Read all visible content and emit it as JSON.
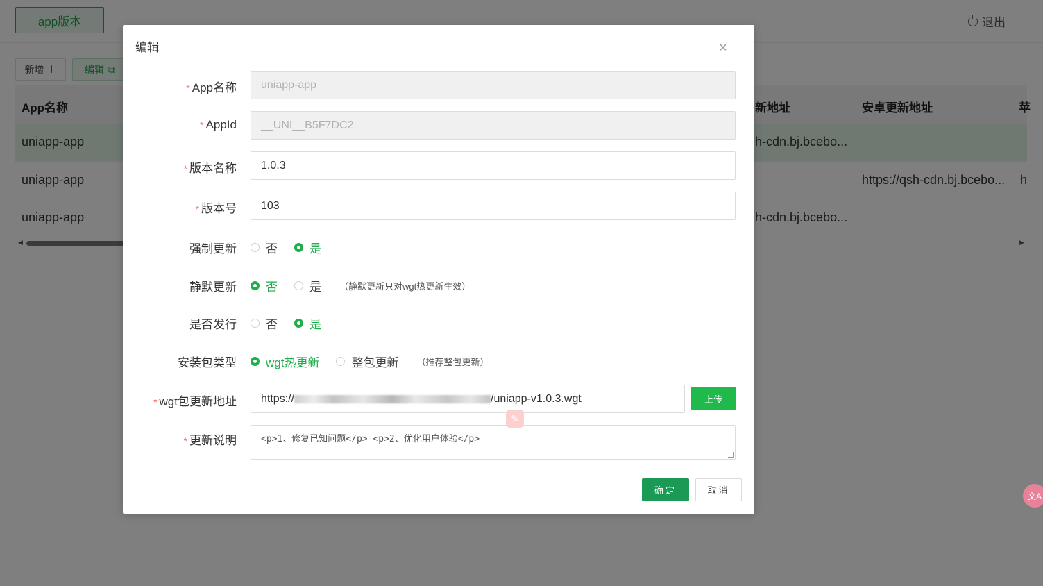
{
  "header": {
    "tab_label": "app版本",
    "logout_label": "退出"
  },
  "toolbar": {
    "add_label": "新增 ＋",
    "edit_label": "编辑"
  },
  "table": {
    "headers": [
      "App名称",
      "新地址",
      "安卓更新地址",
      "苹"
    ],
    "rows": [
      {
        "app_name": "uniapp-app",
        "col_update": "h-cdn.bj.bcebo...",
        "android_url": ""
      },
      {
        "app_name": "uniapp-app",
        "col_update": "",
        "android_url": "https://qsh-cdn.bj.bcebo...",
        "extra": "h"
      },
      {
        "app_name": "uniapp-app",
        "col_update": "h-cdn.bj.bcebo...",
        "android_url": ""
      }
    ]
  },
  "modal": {
    "title": "编辑",
    "close_glyph": "×",
    "fields": {
      "app_name": {
        "label": "App名称",
        "value": "uniapp-app"
      },
      "app_id": {
        "label": "AppId",
        "value": "__UNI__B5F7DC2"
      },
      "version_name": {
        "label": "版本名称",
        "value": "1.0.3"
      },
      "version_code": {
        "label": "版本号",
        "value": "103"
      },
      "force_update": {
        "label": "强制更新",
        "options": [
          "否",
          "是"
        ],
        "selected": "是"
      },
      "silent_update": {
        "label": "静默更新",
        "options": [
          "否",
          "是"
        ],
        "selected": "否",
        "hint": "（静默更新只对wgt热更新生效）"
      },
      "published": {
        "label": "是否发行",
        "options": [
          "否",
          "是"
        ],
        "selected": "是"
      },
      "package_type": {
        "label": "安装包类型",
        "options": [
          "wgt热更新",
          "整包更新"
        ],
        "selected": "wgt热更新",
        "hint": "（推荐整包更新）"
      },
      "wgt_url": {
        "label": "wgt包更新地址",
        "prefix": "https://",
        "suffix": "/uniapp-v1.0.3.wgt",
        "upload_label": "上传"
      },
      "release_notes": {
        "label": "更新说明",
        "value": "<p>1、修复已知问题</p> <p>2、优化用户体验</p>"
      }
    },
    "ok_label": "确定",
    "cancel_label": "取消"
  },
  "colors": {
    "accent": "#1fae4b",
    "required": "#f56c6c",
    "ok_button": "#1a9a54"
  }
}
